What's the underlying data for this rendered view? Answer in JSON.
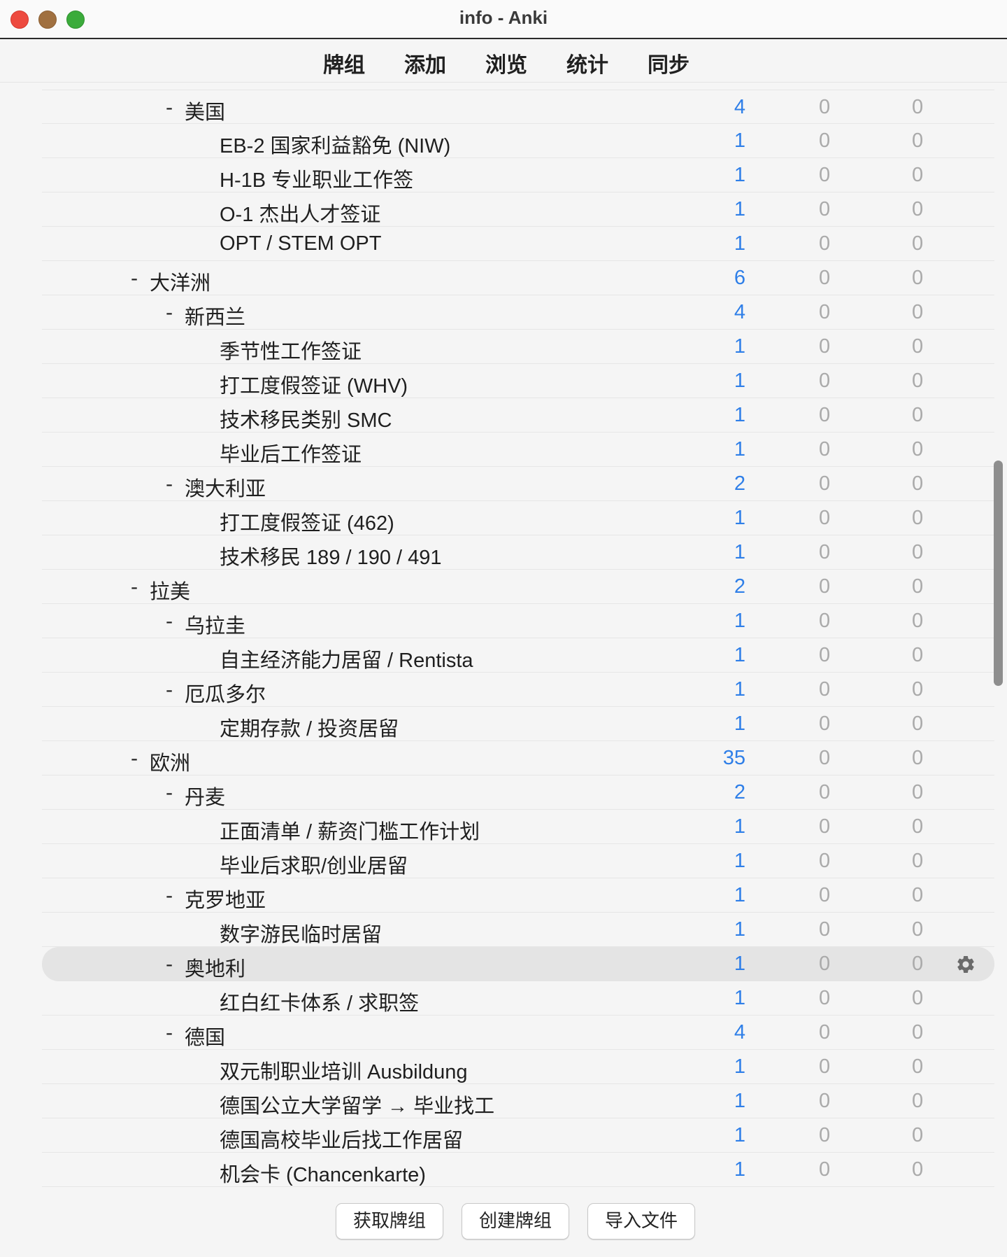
{
  "window": {
    "title": "info - Anki"
  },
  "toolbar": {
    "decks": "牌组",
    "add": "添加",
    "browse": "浏览",
    "stats": "统计",
    "sync": "同步"
  },
  "decks": [
    {
      "level": 2,
      "collapse": "-",
      "name": "美国",
      "new": "4",
      "learn": "0",
      "due": "0"
    },
    {
      "level": 3,
      "collapse": "",
      "name": "EB-2 国家利益豁免 (NIW)",
      "new": "1",
      "learn": "0",
      "due": "0"
    },
    {
      "level": 3,
      "collapse": "",
      "name": "H-1B 专业职业工作签",
      "new": "1",
      "learn": "0",
      "due": "0"
    },
    {
      "level": 3,
      "collapse": "",
      "name": "O-1 杰出人才签证",
      "new": "1",
      "learn": "0",
      "due": "0"
    },
    {
      "level": 3,
      "collapse": "",
      "name": "OPT / STEM OPT",
      "new": "1",
      "learn": "0",
      "due": "0"
    },
    {
      "level": 1,
      "collapse": "-",
      "name": "大洋洲",
      "new": "6",
      "learn": "0",
      "due": "0"
    },
    {
      "level": 2,
      "collapse": "-",
      "name": "新西兰",
      "new": "4",
      "learn": "0",
      "due": "0"
    },
    {
      "level": 3,
      "collapse": "",
      "name": "季节性工作签证",
      "new": "1",
      "learn": "0",
      "due": "0"
    },
    {
      "level": 3,
      "collapse": "",
      "name": "打工度假签证 (WHV)",
      "new": "1",
      "learn": "0",
      "due": "0"
    },
    {
      "level": 3,
      "collapse": "",
      "name": "技术移民类别 SMC",
      "new": "1",
      "learn": "0",
      "due": "0"
    },
    {
      "level": 3,
      "collapse": "",
      "name": "毕业后工作签证",
      "new": "1",
      "learn": "0",
      "due": "0"
    },
    {
      "level": 2,
      "collapse": "-",
      "name": "澳大利亚",
      "new": "2",
      "learn": "0",
      "due": "0"
    },
    {
      "level": 3,
      "collapse": "",
      "name": "打工度假签证 (462)",
      "new": "1",
      "learn": "0",
      "due": "0"
    },
    {
      "level": 3,
      "collapse": "",
      "name": "技术移民 189 / 190 / 491",
      "new": "1",
      "learn": "0",
      "due": "0"
    },
    {
      "level": 1,
      "collapse": "-",
      "name": "拉美",
      "new": "2",
      "learn": "0",
      "due": "0"
    },
    {
      "level": 2,
      "collapse": "-",
      "name": "乌拉圭",
      "new": "1",
      "learn": "0",
      "due": "0"
    },
    {
      "level": 3,
      "collapse": "",
      "name": "自主经济能力居留 / Rentista",
      "new": "1",
      "learn": "0",
      "due": "0"
    },
    {
      "level": 2,
      "collapse": "-",
      "name": "厄瓜多尔",
      "new": "1",
      "learn": "0",
      "due": "0"
    },
    {
      "level": 3,
      "collapse": "",
      "name": "定期存款 / 投资居留",
      "new": "1",
      "learn": "0",
      "due": "0"
    },
    {
      "level": 1,
      "collapse": "-",
      "name": "欧洲",
      "new": "35",
      "learn": "0",
      "due": "0"
    },
    {
      "level": 2,
      "collapse": "-",
      "name": "丹麦",
      "new": "2",
      "learn": "0",
      "due": "0"
    },
    {
      "level": 3,
      "collapse": "",
      "name": "正面清单 / 薪资门槛工作计划",
      "new": "1",
      "learn": "0",
      "due": "0"
    },
    {
      "level": 3,
      "collapse": "",
      "name": "毕业后求职/创业居留",
      "new": "1",
      "learn": "0",
      "due": "0"
    },
    {
      "level": 2,
      "collapse": "-",
      "name": "克罗地亚",
      "new": "1",
      "learn": "0",
      "due": "0"
    },
    {
      "level": 3,
      "collapse": "",
      "name": "数字游民临时居留",
      "new": "1",
      "learn": "0",
      "due": "0"
    },
    {
      "level": 2,
      "collapse": "-",
      "name": "奥地利",
      "new": "1",
      "learn": "0",
      "due": "0",
      "selected": true
    },
    {
      "level": 3,
      "collapse": "",
      "name": "红白红卡体系 / 求职签",
      "new": "1",
      "learn": "0",
      "due": "0"
    },
    {
      "level": 2,
      "collapse": "-",
      "name": "德国",
      "new": "4",
      "learn": "0",
      "due": "0"
    },
    {
      "level": 3,
      "collapse": "",
      "name": "双元制职业培训 Ausbildung",
      "new": "1",
      "learn": "0",
      "due": "0"
    },
    {
      "level": 3,
      "collapse": "",
      "name": "德国公立大学留学 → 毕业找工",
      "new": "1",
      "learn": "0",
      "due": "0"
    },
    {
      "level": 3,
      "collapse": "",
      "name": "德国高校毕业后找工作居留",
      "new": "1",
      "learn": "0",
      "due": "0"
    },
    {
      "level": 3,
      "collapse": "",
      "name": "机会卡 (Chancenkarte)",
      "new": "1",
      "learn": "0",
      "due": "0"
    }
  ],
  "bottom": {
    "get_shared": "获取牌组",
    "create_deck": "创建牌组",
    "import_file": "导入文件"
  },
  "icons": {
    "options": "gear-icon"
  },
  "colors": {
    "new_count": "#2f7fe8",
    "zero_count": "#aaaaaa",
    "selected_row": "#e4e4e4"
  }
}
